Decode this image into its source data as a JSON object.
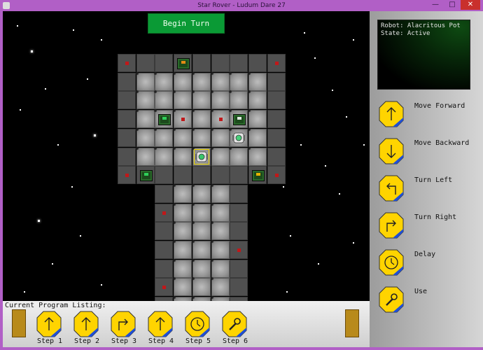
{
  "window": {
    "title": "Star Rover - Ludum Dare 27",
    "minimize": "—",
    "maximize": "□",
    "close": "✕"
  },
  "actions": {
    "begin_turn": "Begin Turn"
  },
  "status": {
    "robot_line": "Robot: Alacritous Pot",
    "state_line": "State: Active"
  },
  "commands": [
    {
      "id": "move-forward",
      "label": "Move Forward",
      "icon": "arrow-up-icon"
    },
    {
      "id": "move-backward",
      "label": "Move Backward",
      "icon": "arrow-down-icon"
    },
    {
      "id": "turn-left",
      "label": "Turn Left",
      "icon": "turn-left-icon"
    },
    {
      "id": "turn-right",
      "label": "Turn Right",
      "icon": "turn-right-icon"
    },
    {
      "id": "delay",
      "label": "Delay",
      "icon": "clock-icon"
    },
    {
      "id": "use",
      "label": "Use",
      "icon": "wrench-icon"
    }
  ],
  "program": {
    "title": "Current Program Listing:",
    "steps": [
      {
        "label": "Step 1",
        "icon": "arrow-up-icon"
      },
      {
        "label": "Step 2",
        "icon": "arrow-up-icon"
      },
      {
        "label": "Step 3",
        "icon": "turn-right-icon"
      },
      {
        "label": "Step 4",
        "icon": "arrow-up-icon"
      },
      {
        "label": "Step 5",
        "icon": "clock-icon"
      },
      {
        "label": "Step 6",
        "icon": "wrench-icon"
      }
    ]
  },
  "colors": {
    "tile_yellow": "#ffd400",
    "tile_blue": "#1f4fd6",
    "begin_green": "#0a9a35",
    "marker_red": "#c0181a",
    "slot_gold": "#b88a1b"
  }
}
